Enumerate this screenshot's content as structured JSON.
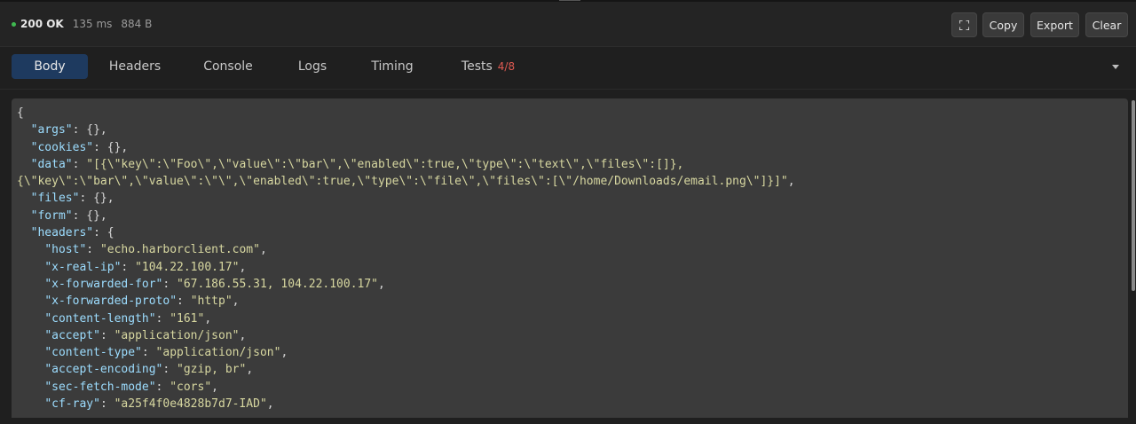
{
  "status": {
    "code": "200 OK",
    "time": "135 ms",
    "size": "884 B",
    "dot_color": "#3fb950"
  },
  "toolbar": {
    "expand_icon": "expand-icon",
    "copy_label": "Copy",
    "export_label": "Export",
    "clear_label": "Clear"
  },
  "tabs": [
    {
      "label": "Body",
      "active": true
    },
    {
      "label": "Headers"
    },
    {
      "label": "Console"
    },
    {
      "label": "Logs"
    },
    {
      "label": "Timing"
    },
    {
      "label": "Tests",
      "count": "4/8",
      "count_color": "#e05a52"
    }
  ],
  "colors": {
    "accent": "#1e3a5f",
    "panel": "#3b3b3b"
  },
  "body_lines": [
    {
      "indent": "",
      "pre": "{"
    },
    {
      "indent": "  ",
      "key": "\"args\"",
      "sep": ": ",
      "post": "{},"
    },
    {
      "indent": "  ",
      "key": "\"cookies\"",
      "sep": ": ",
      "post": "{},"
    },
    {
      "indent": "  ",
      "key": "\"data\"",
      "sep": ": ",
      "val": "\"[{\\\"key\\\":\\\"Foo\\\",\\\"value\\\":\\\"bar\\\",\\\"enabled\\\":true,\\\"type\\\":\\\"text\\\",\\\"files\\\":[]},"
    },
    {
      "indent": "",
      "val": "{\\\"key\\\":\\\"bar\\\",\\\"value\\\":\\\"\\\",\\\"enabled\\\":true,\\\"type\\\":\\\"file\\\",\\\"files\\\":[\\\"/home/Downloads/email.png\\\"]}]\"",
      "post": ","
    },
    {
      "indent": "  ",
      "key": "\"files\"",
      "sep": ": ",
      "post": "{},"
    },
    {
      "indent": "  ",
      "key": "\"form\"",
      "sep": ": ",
      "post": "{},"
    },
    {
      "indent": "  ",
      "key": "\"headers\"",
      "sep": ": ",
      "post": "{"
    },
    {
      "indent": "    ",
      "key": "\"host\"",
      "sep": ": ",
      "val": "\"echo.harborclient.com\"",
      "post": ","
    },
    {
      "indent": "    ",
      "key": "\"x-real-ip\"",
      "sep": ": ",
      "val": "\"104.22.100.17\"",
      "post": ","
    },
    {
      "indent": "    ",
      "key": "\"x-forwarded-for\"",
      "sep": ": ",
      "val": "\"67.186.55.31, 104.22.100.17\"",
      "post": ","
    },
    {
      "indent": "    ",
      "key": "\"x-forwarded-proto\"",
      "sep": ": ",
      "val": "\"http\"",
      "post": ","
    },
    {
      "indent": "    ",
      "key": "\"content-length\"",
      "sep": ": ",
      "val": "\"161\"",
      "post": ","
    },
    {
      "indent": "    ",
      "key": "\"accept\"",
      "sep": ": ",
      "val": "\"application/json\"",
      "post": ","
    },
    {
      "indent": "    ",
      "key": "\"content-type\"",
      "sep": ": ",
      "val": "\"application/json\"",
      "post": ","
    },
    {
      "indent": "    ",
      "key": "\"accept-encoding\"",
      "sep": ": ",
      "val": "\"gzip, br\"",
      "post": ","
    },
    {
      "indent": "    ",
      "key": "\"sec-fetch-mode\"",
      "sep": ": ",
      "val": "\"cors\"",
      "post": ","
    },
    {
      "indent": "    ",
      "key": "\"cf-ray\"",
      "sep": ": ",
      "val": "\"a25f4f0e4828b7d7-IAD\"",
      "post": ","
    }
  ]
}
